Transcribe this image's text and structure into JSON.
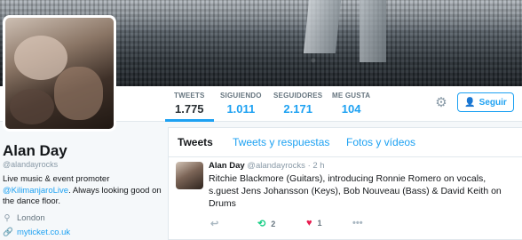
{
  "profile": {
    "name": "Alan Day",
    "handle": "@alandayrocks",
    "bio_line1": "Live music & event promoter",
    "bio_mention": "@KilimanjaroLive",
    "bio_rest": ". Always looking good on the dance floor.",
    "location": "London",
    "website": "myticket.co.uk"
  },
  "stats": [
    {
      "label": "TWEETS",
      "value": "1.775"
    },
    {
      "label": "SIGUIENDO",
      "value": "1.011"
    },
    {
      "label": "SEGUIDORES",
      "value": "2.171"
    },
    {
      "label": "ME GUSTA",
      "value": "104"
    }
  ],
  "actions": {
    "follow_label": "Seguir"
  },
  "tabs": [
    {
      "label": "Tweets"
    },
    {
      "label": "Tweets y respuestas"
    },
    {
      "label": "Fotos y vídeos"
    }
  ],
  "tweet": {
    "name": "Alan Day",
    "handle": "@alandayrocks",
    "time": "· 2 h",
    "text": "Ritchie Blackmore (Guitars), introducing Ronnie Romero on vocals, s.guest Jens Johansson (Keys), Bob Nouveau (Bass) & David Keith on Drums",
    "retweets": "2",
    "likes": "1"
  },
  "colors": {
    "accent": "#1da1f2",
    "retweet": "#19cf86",
    "like": "#e81c4f"
  },
  "icons": {
    "gear": "gear-icon",
    "follow": "add-user-icon",
    "location": "location-pin-icon",
    "link": "link-icon",
    "reply": "reply-icon",
    "retweet": "retweet-icon",
    "like": "heart-icon",
    "more": "more-icon"
  }
}
